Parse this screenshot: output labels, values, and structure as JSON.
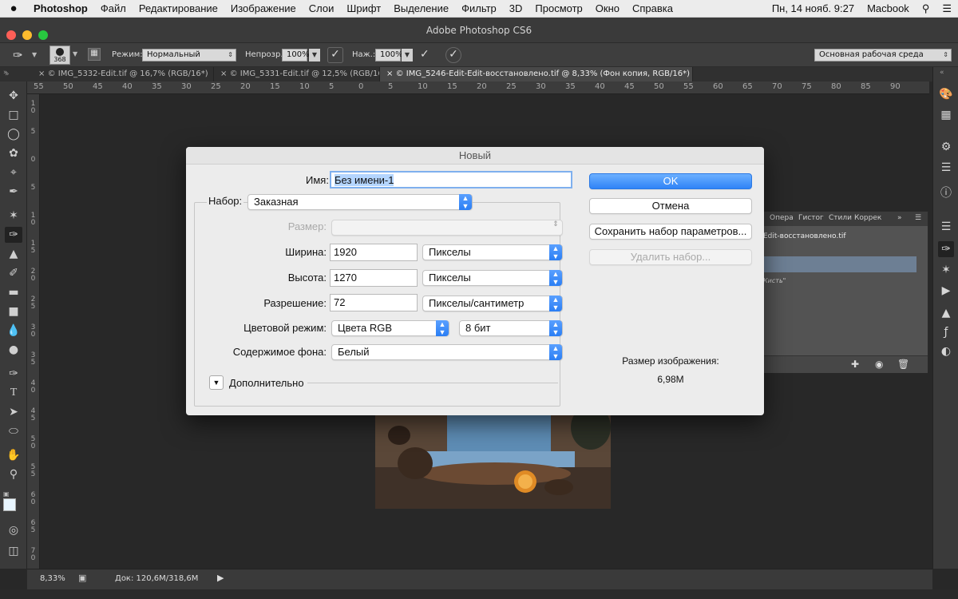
{
  "menubar": {
    "apple": "",
    "app": "Photoshop",
    "items": [
      "Файл",
      "Редактирование",
      "Изображение",
      "Слои",
      "Шрифт",
      "Выделение",
      "Фильтр",
      "3D",
      "Просмотр",
      "Окно",
      "Справка"
    ],
    "clock": "Пн, 14 нояб.  9:27",
    "user": "Macbook"
  },
  "window": {
    "title": "Adobe Photoshop CS6"
  },
  "options": {
    "brush_size": "368",
    "mode_label": "Режим:",
    "mode_value": "Нормальный",
    "opacity_label": "Непрозр.:",
    "opacity_value": "100%",
    "pressure_label": "Наж.:",
    "pressure_value": "100%",
    "workspace": "Основная рабочая среда"
  },
  "tabs": [
    "© IMG_5332-Edit.tif @ 16,7% (RGB/16*)",
    "© IMG_5331-Edit.tif @ 12,5% (RGB/16*)",
    "© IMG_5246-Edit-Edit-восстановлено.tif @ 8,33% (Фон копия, RGB/16*) *"
  ],
  "ruler_top": [
    "55",
    "50",
    "45",
    "40",
    "35",
    "30",
    "25",
    "20",
    "15",
    "10",
    "5",
    "0",
    "5",
    "10",
    "15",
    "20",
    "25",
    "30",
    "35",
    "40",
    "45",
    "50",
    "55",
    "60",
    "65",
    "70",
    "75",
    "80",
    "85",
    "90"
  ],
  "ruler_left": [
    "1 0",
    "5",
    "0",
    "5",
    "1 0",
    "1 5",
    "2 0",
    "2 5",
    "3 0",
    "3 5",
    "4 0",
    "4 5",
    "5 0",
    "5 5",
    "6 0",
    "6 5",
    "7 0"
  ],
  "panel": {
    "tabs": [
      "Опера",
      "Гистог",
      "Стили",
      "Коррек"
    ],
    "layer_name": "Edit-восстановлено.tif",
    "row2": "Кисть\""
  },
  "status": {
    "zoom": "8,33%",
    "doc": "Док: 120,6M/318,6M"
  },
  "dialog": {
    "title": "Новый",
    "name_label": "Имя:",
    "name_value": "Без имени-1",
    "preset_label": "Набор:",
    "preset_value": "Заказная",
    "size_label": "Размер:",
    "width_label": "Ширина:",
    "width_value": "1920",
    "width_unit": "Пикселы",
    "height_label": "Высота:",
    "height_value": "1270",
    "height_unit": "Пикселы",
    "res_label": "Разрешение:",
    "res_value": "72",
    "res_unit": "Пикселы/сантиметр",
    "color_label": "Цветовой режим:",
    "color_value": "Цвета RGB",
    "bits_value": "8 бит",
    "bg_label": "Содержимое фона:",
    "bg_value": "Белый",
    "advanced_label": "Дополнительно",
    "ok": "OK",
    "cancel": "Отмена",
    "save_preset": "Сохранить набор параметров...",
    "delete_preset": "Удалить набор...",
    "image_size_label": "Размер изображения:",
    "image_size_value": "6,98M"
  }
}
